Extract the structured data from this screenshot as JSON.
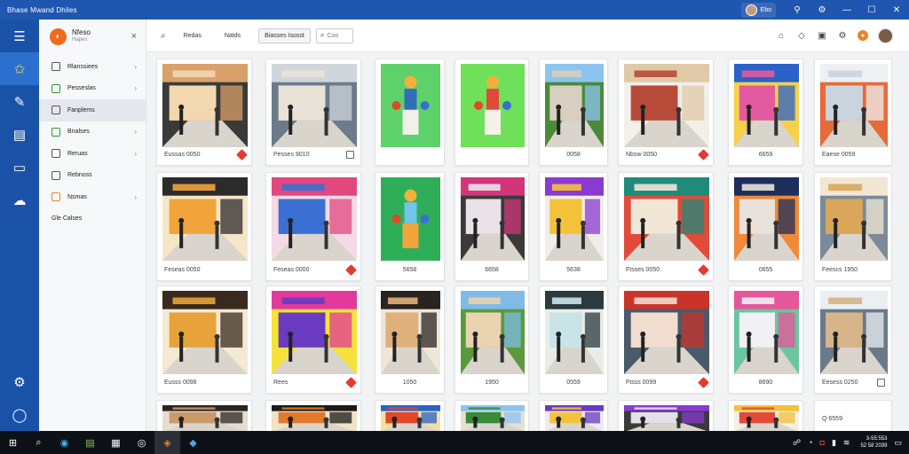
{
  "window": {
    "title": "Bhase Mwand Dhiles",
    "account_label": "Ebo",
    "controls": [
      "bell-icon",
      "user-icon",
      "minimize-icon",
      "maximize-icon",
      "close-icon"
    ]
  },
  "rail": {
    "items": [
      {
        "name": "menu",
        "glyph": "☰"
      },
      {
        "name": "favorites",
        "glyph": "☆"
      },
      {
        "name": "edit",
        "glyph": "✎"
      },
      {
        "name": "gallery",
        "glyph": "▦"
      },
      {
        "name": "media",
        "glyph": "▭"
      },
      {
        "name": "cloud",
        "glyph": "☁"
      }
    ],
    "bottom": [
      {
        "name": "settings",
        "glyph": "⚙"
      },
      {
        "name": "account",
        "glyph": "◯"
      }
    ]
  },
  "panel": {
    "brand_name": "Nfeso",
    "brand_sub": "Hapes",
    "close": "×",
    "items": [
      {
        "label": "Rlanssiees",
        "chevron": "›",
        "icon_color": "#555555"
      },
      {
        "label": "Pesseslas",
        "chevron": "›",
        "icon_color": "#2f9a3c"
      },
      {
        "label": "Fanplems",
        "chevron": "",
        "icon_color": "#555555"
      },
      {
        "label": "Bnalses",
        "chevron": "›",
        "icon_color": "#2f9a3c"
      },
      {
        "label": "Reruas",
        "chevron": "›",
        "icon_color": "#555555"
      },
      {
        "label": "Rebnoss",
        "chevron": "",
        "icon_color": "#555555"
      },
      {
        "label": "Nsmas",
        "chevron": "›",
        "icon_color": "#e9852a"
      },
      {
        "label": "Gle Calses",
        "chevron": "",
        "icon_color": ""
      }
    ]
  },
  "toolbar": {
    "tabs": [
      "Redas",
      "Natds",
      "Biasses Isosst"
    ],
    "search_placeholder": "Coo",
    "right_icons": [
      "home-icon",
      "chat-icon",
      "grid-icon",
      "settings-icon",
      "badge-icon",
      "avatar"
    ]
  },
  "gallery": {
    "cards": [
      {
        "caption": "Eussas 0050",
        "scene": "mall-interior",
        "badge": "red",
        "caption_align": "left"
      },
      {
        "caption": "Pesses 9010",
        "scene": "mall-corridor",
        "badge": "icon",
        "caption_align": "left"
      },
      {
        "caption": "",
        "scene": "toy-green",
        "badge": "",
        "caption_align": "left"
      },
      {
        "caption": "",
        "scene": "toy-green2",
        "badge": "",
        "caption_align": "left"
      },
      {
        "caption": "0058",
        "scene": "outdoor",
        "badge": "",
        "caption_align": "center"
      },
      {
        "caption": "Nbsw 0050",
        "scene": "storefront",
        "badge": "red",
        "caption_align": "left"
      },
      {
        "caption": "6659",
        "scene": "colorful-store",
        "badge": "",
        "caption_align": "center"
      },
      {
        "caption": "Eaese 0059",
        "scene": "mall-white",
        "badge": "",
        "caption_align": "left"
      },
      {
        "caption": "Feseas 0050",
        "scene": "store-orange",
        "badge": "",
        "caption_align": "left"
      },
      {
        "caption": "Feseas 0000",
        "scene": "fashion-store",
        "badge": "red",
        "caption_align": "left"
      },
      {
        "caption": "5658",
        "scene": "toy-forest",
        "badge": "",
        "caption_align": "center"
      },
      {
        "caption": "6658",
        "scene": "mall-pink",
        "badge": "",
        "caption_align": "center"
      },
      {
        "caption": "5638",
        "scene": "store-purple",
        "badge": "",
        "caption_align": "center"
      },
      {
        "caption": "Ftsses 0050",
        "scene": "store-teal",
        "badge": "red",
        "caption_align": "left"
      },
      {
        "caption": "0655",
        "scene": "store-navy",
        "badge": "",
        "caption_align": "center"
      },
      {
        "caption": "Feescs 1950",
        "scene": "mall-bright",
        "badge": "",
        "caption_align": "left"
      },
      {
        "caption": "Eusss 0098",
        "scene": "store-orange2",
        "badge": "",
        "caption_align": "left"
      },
      {
        "caption": "Rees",
        "scene": "store-pink",
        "badge": "red",
        "caption_align": "left"
      },
      {
        "caption": "1050",
        "scene": "store-dark",
        "badge": "",
        "caption_align": "center"
      },
      {
        "caption": "1950",
        "scene": "outdoor-mall",
        "badge": "",
        "caption_align": "center"
      },
      {
        "caption": "0559",
        "scene": "store-glass",
        "badge": "",
        "caption_align": "center"
      },
      {
        "caption": "Ftsss 0099",
        "scene": "mall-red",
        "badge": "red",
        "caption_align": "left"
      },
      {
        "caption": "8690",
        "scene": "store-pink2",
        "badge": "",
        "caption_align": "center"
      },
      {
        "caption": "Eesess 0250",
        "scene": "mall-outdoor2",
        "badge": "icon",
        "caption_align": "left"
      },
      {
        "caption": "",
        "scene": "partial-1",
        "badge": "",
        "caption_align": "left"
      },
      {
        "caption": "",
        "scene": "partial-2",
        "badge": "",
        "caption_align": "left"
      },
      {
        "caption": "",
        "scene": "partial-3",
        "badge": "",
        "caption_align": "left"
      },
      {
        "caption": "",
        "scene": "partial-4",
        "badge": "",
        "caption_align": "left"
      },
      {
        "caption": "",
        "scene": "partial-5",
        "badge": "",
        "caption_align": "left"
      },
      {
        "caption": "",
        "scene": "partial-6",
        "badge": "",
        "caption_align": "left"
      },
      {
        "caption": "",
        "scene": "partial-7",
        "badge": "",
        "caption_align": "left"
      },
      {
        "caption": "Q 6559",
        "scene": "blank",
        "badge": "",
        "caption_align": "left"
      }
    ]
  },
  "taskbar": {
    "apps": [
      {
        "name": "start",
        "glyph": "⊞"
      },
      {
        "name": "search",
        "glyph": "⌕"
      },
      {
        "name": "edge",
        "glyph": "◉"
      },
      {
        "name": "files",
        "glyph": "▤"
      },
      {
        "name": "calendar",
        "glyph": "▦"
      },
      {
        "name": "browser",
        "glyph": "◎"
      },
      {
        "name": "app-orange",
        "glyph": "◈"
      },
      {
        "name": "app-blue",
        "glyph": "◆"
      }
    ],
    "time": "3-55:553",
    "date": "52 58 2039"
  }
}
